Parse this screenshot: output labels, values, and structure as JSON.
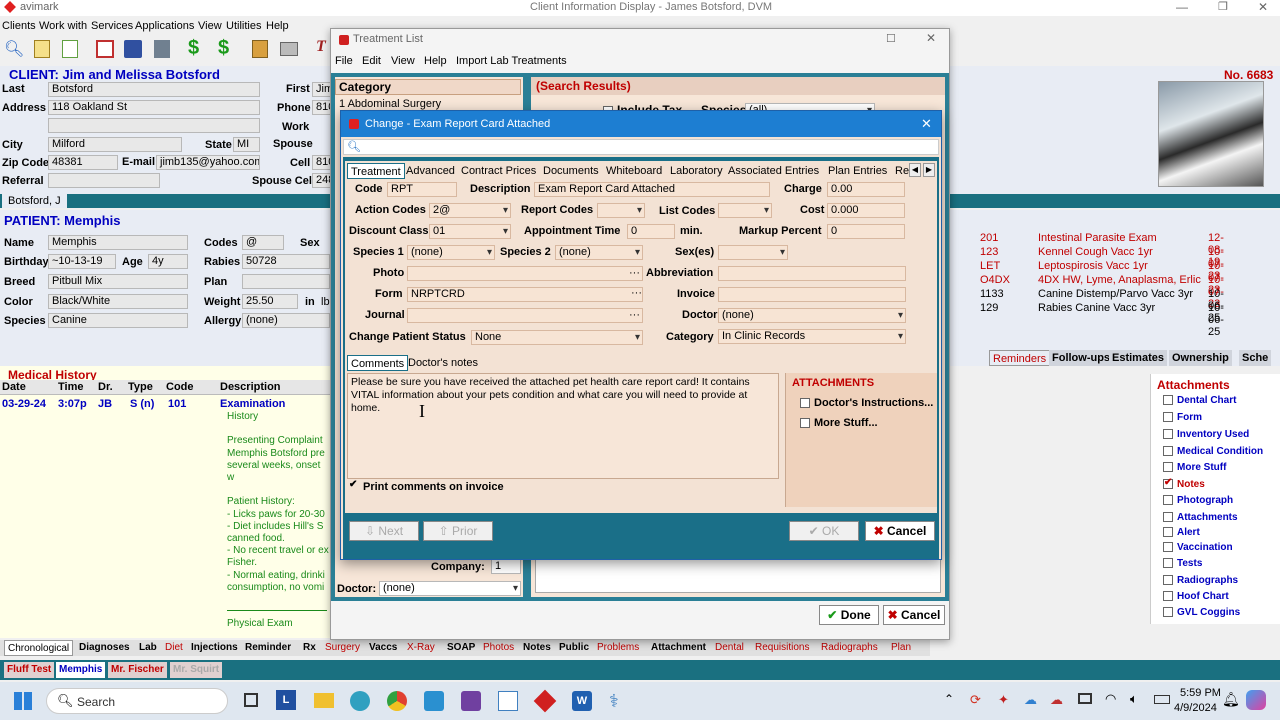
{
  "app": {
    "logo": "avimark",
    "title": "Client Information Display - James Botsford, DVM"
  },
  "menu": [
    "Clients",
    "Work with",
    "Services",
    "Applications",
    "View",
    "Utilities",
    "Help"
  ],
  "client": {
    "header": "CLIENT:  Jim and Melissa Botsford",
    "number": "No. 6683",
    "last_label": "Last",
    "last": "Botsford",
    "first_label": "First",
    "first": "Jim",
    "address_label": "Address",
    "address": "118 Oakland St",
    "phone_label": "Phone",
    "phone": "810",
    "work_label": "Work",
    "city_label": "City",
    "city": "Milford",
    "state_label": "State",
    "state": "MI",
    "spouse_label": "Spouse",
    "zip_label": "Zip Code",
    "zip": "48381",
    "email_label": "E-mail",
    "email": "jimb135@yahoo.com",
    "cell_label": "Cell",
    "cell": "810",
    "referral_label": "Referral",
    "spouse_cell_label": "Spouse Cell",
    "spouse_cell": "248",
    "tab": "Botsford, J"
  },
  "patient": {
    "header": "PATIENT:  Memphis",
    "name_label": "Name",
    "name": "Memphis",
    "codes_label": "Codes",
    "codes": "@",
    "sex_label": "Sex",
    "sex": "N",
    "birthday_label": "Birthday",
    "birthday": "~10-13-19",
    "age_label": "Age",
    "age": "4y",
    "rabies_label": "Rabies",
    "rabies": "50728",
    "breed_label": "Breed",
    "breed": "Pitbull Mix",
    "plan_label": "Plan",
    "color_label": "Color",
    "color": "Black/White",
    "weight_label": "Weight",
    "weight": "25.50",
    "weight_in": "in",
    "weight_unit": "lb",
    "species_label": "Species",
    "species": "Canine",
    "allergy_label": "Allergy",
    "allergy": "(none)"
  },
  "reminders": [
    {
      "code": "201",
      "desc": "Intestinal Parasite Exam",
      "date": "12-08-19",
      "due": true
    },
    {
      "code": "123",
      "desc": "Kennel Cough Vacc 1yr",
      "date": "10-07-23",
      "due": true
    },
    {
      "code": "LET",
      "desc": "Leptospirosis Vacc 1yr",
      "date": "10-07-23",
      "due": true
    },
    {
      "code": "O4DX",
      "desc": "4DX HW, Lyme, Anaplasma, Erlic",
      "date": "10-07-23",
      "due": true
    },
    {
      "code": "1133",
      "desc": "Canine Distemp/Parvo Vacc 3yr",
      "date": "10-06-25",
      "due": false
    },
    {
      "code": "129",
      "desc": "Rabies Canine Vacc 3yr",
      "date": "10-06-25",
      "due": false
    }
  ],
  "reminder_tabs": [
    "Reminders",
    "Follow-ups",
    "Estimates",
    "Ownership",
    "Sche"
  ],
  "attachments_panel": {
    "title": "Attachments",
    "items": [
      {
        "label": "Dental Chart",
        "checked": false
      },
      {
        "label": "Form",
        "checked": false
      },
      {
        "label": "Inventory Used",
        "checked": false
      },
      {
        "label": "Medical Condition",
        "checked": false
      },
      {
        "label": "More Stuff",
        "checked": false
      },
      {
        "label": "Notes",
        "checked": true
      },
      {
        "label": "Photograph",
        "checked": false
      },
      {
        "label": "Attachments",
        "checked": false
      },
      {
        "label": "Alert",
        "checked": false
      },
      {
        "label": "Vaccination",
        "checked": false
      },
      {
        "label": "Tests",
        "checked": false
      },
      {
        "label": "Radiographs",
        "checked": false
      },
      {
        "label": "Hoof Chart",
        "checked": false
      },
      {
        "label": "GVL Coggins",
        "checked": false
      }
    ]
  },
  "medical_history": {
    "title": "Medical History",
    "columns": [
      "Date",
      "Time",
      "Dr.",
      "Type",
      "Code",
      "Description"
    ],
    "row": {
      "date": "03-29-24",
      "time": "3:07p",
      "dr": "JB",
      "type": "S (n)",
      "code": "101",
      "desc": "Examination"
    },
    "notes": [
      "History",
      "",
      "Presenting Complaint",
      "Memphis Botsford pre",
      "several weeks, onset w",
      "",
      "Patient History:",
      "- Licks paws for 20-30",
      "- Diet includes Hill's S",
      "canned food.",
      "- No recent travel or ex",
      "Fisher.",
      "- Normal eating, drinki",
      "consumption, no vomi",
      "",
      "",
      "Physical Exam"
    ]
  },
  "bottom_tabs": [
    "Chronological",
    "Diagnoses",
    "Lab",
    "Diet",
    "Injections",
    "Reminder",
    "Rx",
    "Surgery",
    "Vaccs",
    "X-Ray",
    "SOAP",
    "Photos",
    "Notes",
    "Public",
    "Problems",
    "Attachment",
    "Dental",
    "Requisitions",
    "Radiographs",
    "Plan"
  ],
  "patient_tabs": [
    "Fluff Test",
    "Memphis",
    "Mr. Fischer",
    "Mr. Squirt"
  ],
  "treatment_list": {
    "title": "Treatment List",
    "menu": [
      "File",
      "Edit",
      "View",
      "Help",
      "Import Lab Treatments"
    ],
    "category_header": "Category",
    "category_item": "1 Abdominal Surgery",
    "search_results": "(Search Results)",
    "include_tax": "Include Tax",
    "species_label": "Species",
    "species_value": "(all)",
    "company_label": "Company:",
    "company_value": "1",
    "doctor_label": "Doctor:",
    "doctor_value": "(none)",
    "done": "Done",
    "cancel": "Cancel"
  },
  "dialog": {
    "title": "Change - Exam Report Card Attached",
    "tabs": [
      "Treatment",
      "Advanced",
      "Contract Prices",
      "Documents",
      "Whiteboard",
      "Laboratory",
      "Associated Entries",
      "Plan Entries",
      "Re"
    ],
    "code_label": "Code",
    "code": "RPT",
    "description_label": "Description",
    "description": "Exam Report Card Attached",
    "charge_label": "Charge",
    "charge": "0.00",
    "action_codes_label": "Action Codes",
    "action_codes": "2@",
    "report_codes_label": "Report Codes",
    "list_codes_label": "List Codes",
    "cost_label": "Cost",
    "cost": "0.000",
    "discount_class_label": "Discount Class",
    "discount_class": "01",
    "appointment_time_label": "Appointment Time",
    "appointment_time": "0",
    "min_label": "min.",
    "markup_percent_label": "Markup Percent",
    "markup_percent": "0",
    "species1_label": "Species 1",
    "species1": "(none)",
    "species2_label": "Species 2",
    "species2": "(none)",
    "sexes_label": "Sex(es)",
    "photo_label": "Photo",
    "abbreviation_label": "Abbreviation",
    "form_label": "Form",
    "form": "NRPTCRD",
    "invoice_label": "Invoice",
    "journal_label": "Journal",
    "doctor_label": "Doctor",
    "doctor": "(none)",
    "change_status_label": "Change Patient Status",
    "change_status": "None",
    "category_label": "Category",
    "category": "In Clinic Records",
    "comment_tabs": [
      "Comments",
      "Doctor's notes"
    ],
    "comment": "Please be sure you have received the attached pet health care report card!  It contains VITAL information about your pets condition and what care you will need to provide at home.",
    "print_comments": "Print comments on invoice",
    "attachments_title": "ATTACHMENTS",
    "attachments": [
      "Doctor's Instructions...",
      "More Stuff..."
    ],
    "next": "Next",
    "prior": "Prior",
    "ok": "OK",
    "cancel": "Cancel"
  },
  "taskbar": {
    "search": "Search",
    "time": "5:59 PM",
    "date": "4/9/2024"
  }
}
